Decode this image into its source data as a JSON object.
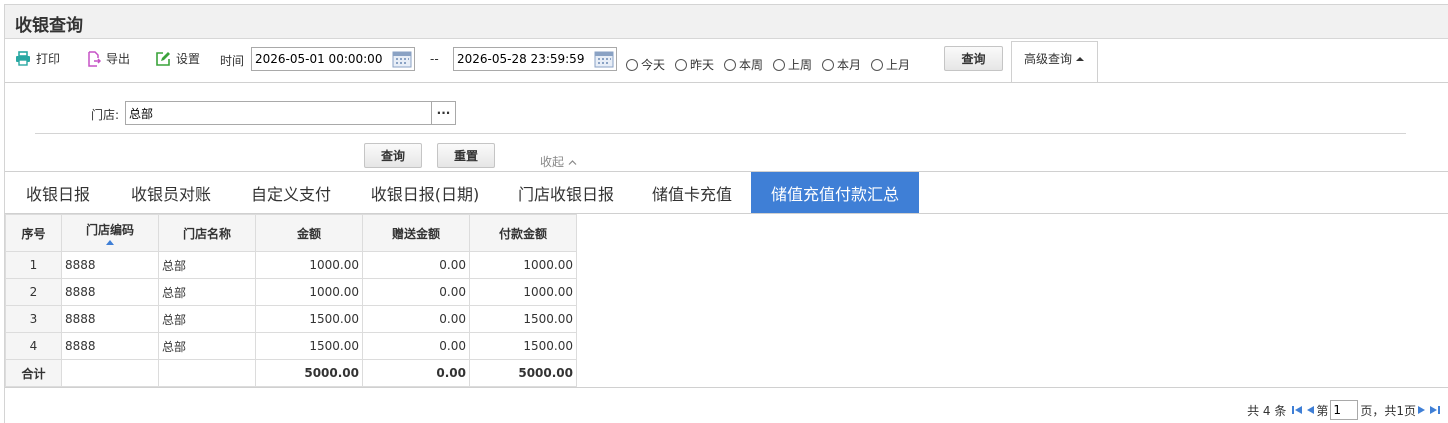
{
  "header": {
    "title": "收银查询"
  },
  "toolbar": {
    "print_label": "打印",
    "export_label": "导出",
    "settings_label": "设置",
    "time_label": "时间",
    "start_date": "2026-05-01 00:00:00",
    "range_sep": "--",
    "end_date": "2026-05-28 23:59:59",
    "radios": [
      "今天",
      "昨天",
      "本周",
      "上周",
      "本月",
      "上月"
    ],
    "query_label": "查询",
    "advanced_label": "高级查询"
  },
  "advanced": {
    "store_label": "门店:",
    "store_value": "总部",
    "dots_label": "···",
    "query_label": "查询",
    "reset_label": "重置",
    "collapse_label": "收起"
  },
  "tabs": [
    "收银日报",
    "收银员对账",
    "自定义支付",
    "收银日报(日期)",
    "门店收银日报",
    "储值卡充值",
    "储值充值付款汇总"
  ],
  "active_tab": "储值充值付款汇总",
  "table": {
    "headers": [
      "序号",
      "门店编码",
      "门店名称",
      "金额",
      "赠送金额",
      "付款金额"
    ],
    "rows": [
      [
        "1",
        "8888",
        "总部",
        "1000.00",
        "0.00",
        "1000.00"
      ],
      [
        "2",
        "8888",
        "总部",
        "1000.00",
        "0.00",
        "1000.00"
      ],
      [
        "3",
        "8888",
        "总部",
        "1500.00",
        "0.00",
        "1500.00"
      ],
      [
        "4",
        "8888",
        "总部",
        "1500.00",
        "0.00",
        "1500.00"
      ]
    ],
    "total": [
      "合计",
      "",
      "",
      "5000.00",
      "0.00",
      "5000.00"
    ]
  },
  "pager": {
    "total_text": "共 4 条",
    "page_prefix": "第",
    "page_value": "1",
    "page_suffix": "页，共1页"
  },
  "colors": {
    "accent": "#3f7fd6",
    "print_icon": "#2aa8a3",
    "export_icon": "#c652c6",
    "settings_icon": "#3aa33a"
  }
}
